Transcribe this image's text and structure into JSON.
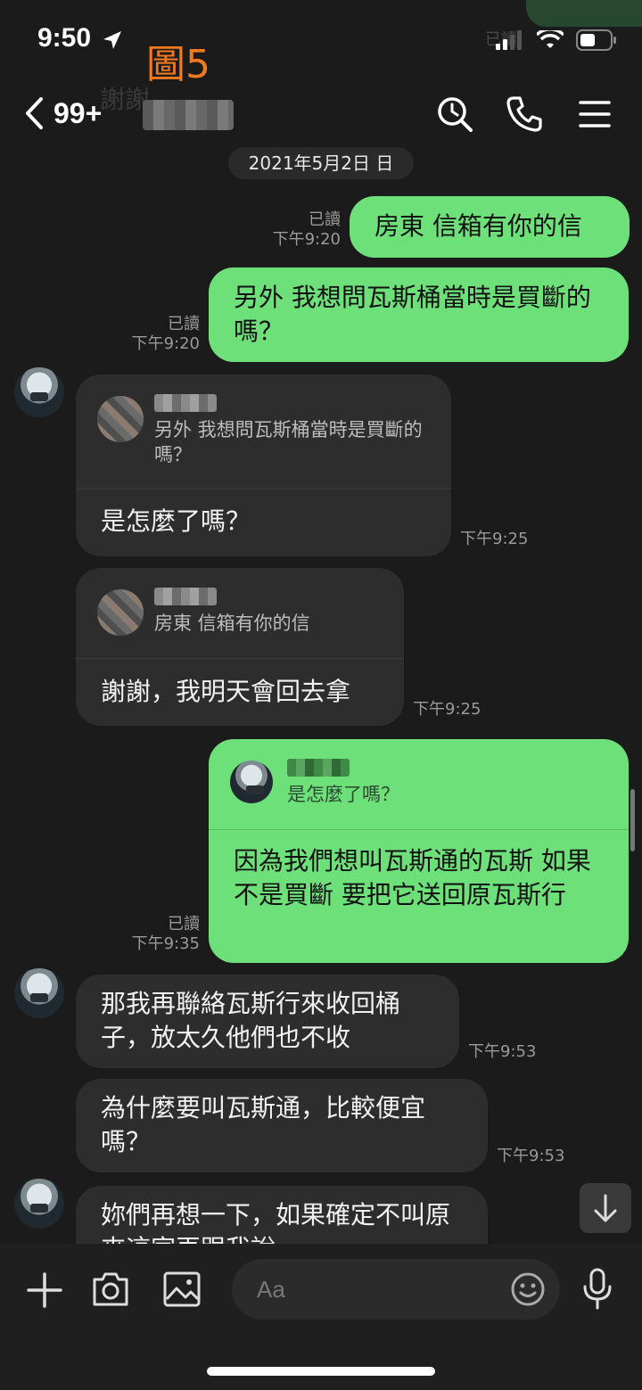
{
  "status_bar": {
    "time": "9:50",
    "figure_label": "圖5"
  },
  "header": {
    "back_label": "99+",
    "ghost_preview": "謝謝"
  },
  "chat": {
    "date": "2021年5月2日 日",
    "messages": [
      {
        "dir": "out",
        "text": "房東 信箱有你的信",
        "read": "已讀",
        "time": "下午9:20"
      },
      {
        "dir": "out",
        "text": "另外 我想問瓦斯桶當時是買斷的嗎？",
        "read": "已讀",
        "time": "下午9:20"
      },
      {
        "dir": "in",
        "quote": "另外 我想問瓦斯桶當時是買斷的嗎？",
        "text": "是怎麼了嗎？",
        "time": "下午9:25"
      },
      {
        "dir": "in",
        "quote": "房東 信箱有你的信",
        "text": "謝謝，我明天會回去拿",
        "time": "下午9:25"
      },
      {
        "dir": "out",
        "quote": "是怎麼了嗎？",
        "text": "因為我們想叫瓦斯通的瓦斯 如果不是買斷 要把它送回原瓦斯行",
        "read": "已讀",
        "time": "下午9:35"
      },
      {
        "dir": "in",
        "text": "那我再聯絡瓦斯行來收回桶子，放太久他們也不收",
        "time": "下午9:53"
      },
      {
        "dir": "in",
        "text": "為什麼要叫瓦斯通，比較便宜嗎？",
        "time": "下午9:53"
      },
      {
        "dir": "in",
        "text": "妳們再想一下，如果確定不叫原來這家再跟我說"
      }
    ]
  },
  "composer": {
    "placeholder": "Aa"
  },
  "icons": [
    "chevron-left-icon",
    "search-icon",
    "phone-icon",
    "menu-icon",
    "plus-icon",
    "camera-icon",
    "image-icon",
    "emoji-icon",
    "microphone-icon",
    "arrow-down-icon",
    "signal-icon",
    "wifi-icon",
    "battery-icon",
    "location-arrow-icon"
  ],
  "colors": {
    "outgoing": "#6ee07a",
    "incoming": "#2d2d2d",
    "background": "#1b1b1b",
    "figure_label": "#f07a1e"
  }
}
